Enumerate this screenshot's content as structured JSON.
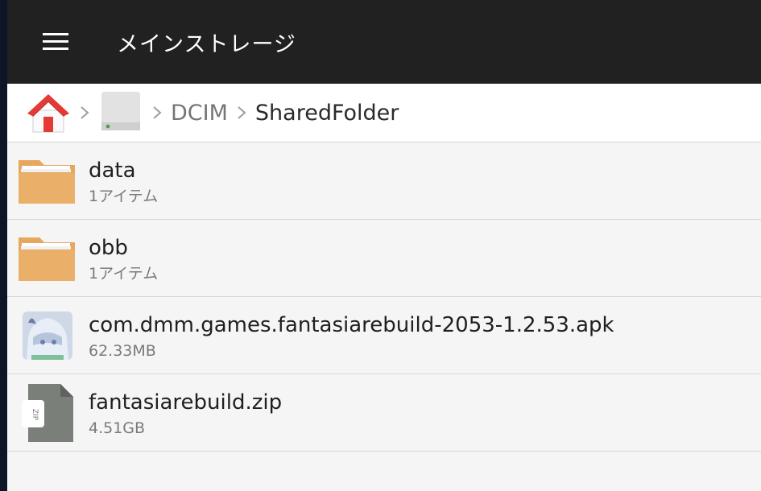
{
  "header": {
    "menu_icon": "hamburger-menu-icon",
    "title": "メインストレージ",
    "background": "#212121"
  },
  "breadcrumb": {
    "home_icon": "home-icon",
    "drive_icon": "drive-icon",
    "items": [
      "DCIM",
      "SharedFolder"
    ]
  },
  "files": [
    {
      "icon": "folder-icon",
      "name": "data",
      "meta": "1アイテム"
    },
    {
      "icon": "folder-icon",
      "name": "obb",
      "meta": "1アイテム"
    },
    {
      "icon": "apk-app-icon",
      "name": "com.dmm.games.fantasiarebuild-2053-1.2.53.apk",
      "meta": "62.33MB"
    },
    {
      "icon": "zip-archive-icon",
      "name": "fantasiarebuild.zip",
      "meta": "4.51GB"
    }
  ],
  "colors": {
    "folder": "#e6a85f",
    "home_roof": "#e53935",
    "zip": "#7a7f79"
  }
}
